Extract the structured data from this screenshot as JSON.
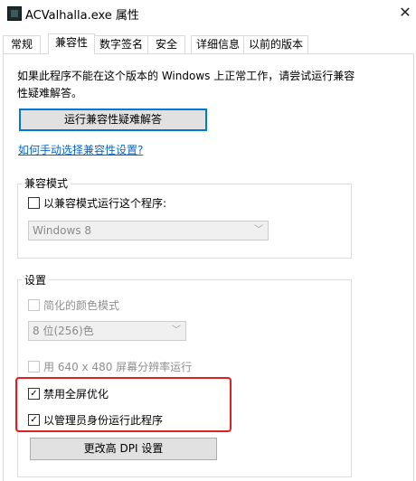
{
  "window": {
    "title": "ACValhalla.exe 属性",
    "close_glyph": "✕"
  },
  "tabs": [
    {
      "label": "常规"
    },
    {
      "label": "兼容性"
    },
    {
      "label": "数字签名"
    },
    {
      "label": "安全"
    },
    {
      "label": "详细信息"
    },
    {
      "label": "以前的版本"
    }
  ],
  "intro": {
    "text": "如果此程序不能在这个版本的 Windows 上正常工作，请尝试运行兼容性疑难解答。"
  },
  "buttons": {
    "troubleshoot": "运行兼容性疑难解答",
    "dpi": "更改高 DPI 设置"
  },
  "link": {
    "manual": "如何手动选择兼容性设置?"
  },
  "compat_mode": {
    "group_label": "兼容模式",
    "checkbox_label": "以兼容模式运行这个程序:",
    "checked": false,
    "os_selected": "Windows 8"
  },
  "settings": {
    "group_label": "设置",
    "reduced_color": {
      "label": "简化的颜色模式",
      "checked": false,
      "enabled": false
    },
    "color_selected": "8 位(256)色",
    "res640": {
      "label": "用 640 x 480 屏幕分辨率运行",
      "checked": false,
      "enabled": false
    },
    "disable_fullscreen": {
      "label": "禁用全屏优化",
      "checked": true
    },
    "run_admin": {
      "label": "以管理员身份运行此程序",
      "checked": true
    },
    "check_glyph": "✓"
  },
  "colors": {
    "highlight": "#e02020",
    "link": "#0b66c6",
    "focus": "#0078d7"
  }
}
